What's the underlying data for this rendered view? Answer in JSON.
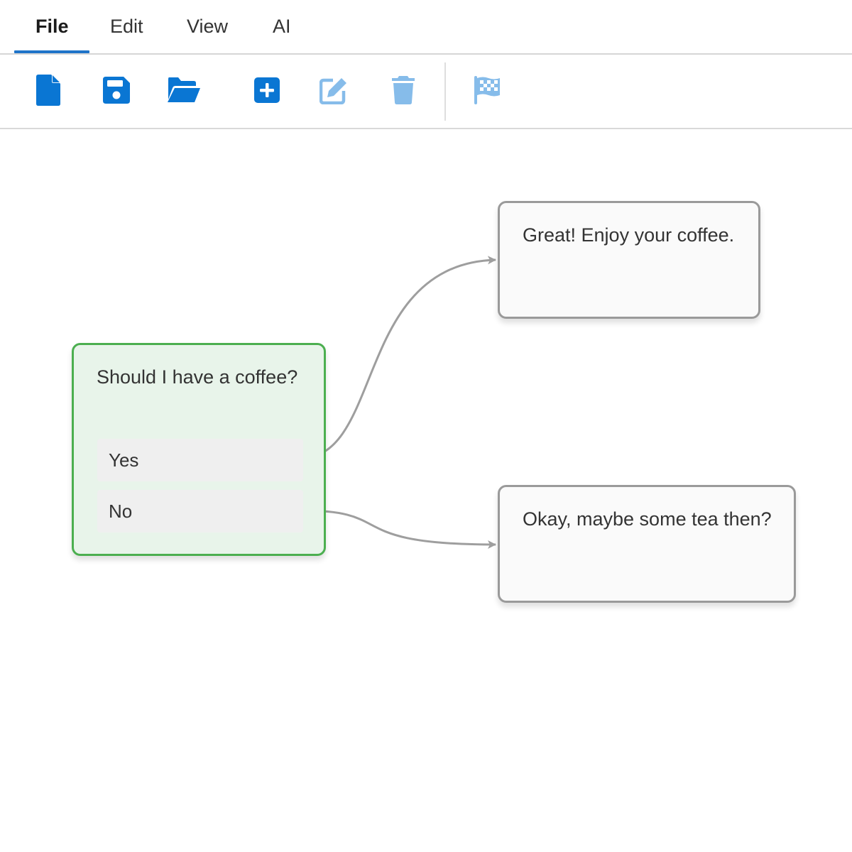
{
  "menu": {
    "items": [
      {
        "label": "File",
        "active": true
      },
      {
        "label": "Edit",
        "active": false
      },
      {
        "label": "View",
        "active": false
      },
      {
        "label": "AI",
        "active": false
      }
    ]
  },
  "toolbar": {
    "tools": [
      {
        "icon": "new-file-icon",
        "enabled": true
      },
      {
        "icon": "save-icon",
        "enabled": true
      },
      {
        "icon": "open-folder-icon",
        "enabled": true
      },
      {
        "icon": "add-node-icon",
        "enabled": true
      },
      {
        "icon": "edit-icon",
        "enabled": false
      },
      {
        "icon": "delete-icon",
        "enabled": false
      },
      {
        "icon": "flag-icon",
        "enabled": false
      }
    ]
  },
  "colors": {
    "accent": "#1f74c9",
    "icon_enabled": "#0a76d3",
    "icon_disabled": "#86bcea",
    "decision_border": "#4caf50",
    "decision_fill": "#e8f4ea",
    "node_border": "#9a9a9a",
    "edge": "#9e9e9e"
  },
  "nodes": {
    "question": {
      "text": "Should I have a coffee?",
      "options": [
        "Yes",
        "No"
      ]
    },
    "answer_yes": {
      "text": "Great! Enjoy your coffee."
    },
    "answer_no": {
      "text": "Okay, maybe some tea then?"
    }
  },
  "edges": [
    {
      "from": "Yes",
      "to": "answer_yes"
    },
    {
      "from": "No",
      "to": "answer_no"
    }
  ]
}
